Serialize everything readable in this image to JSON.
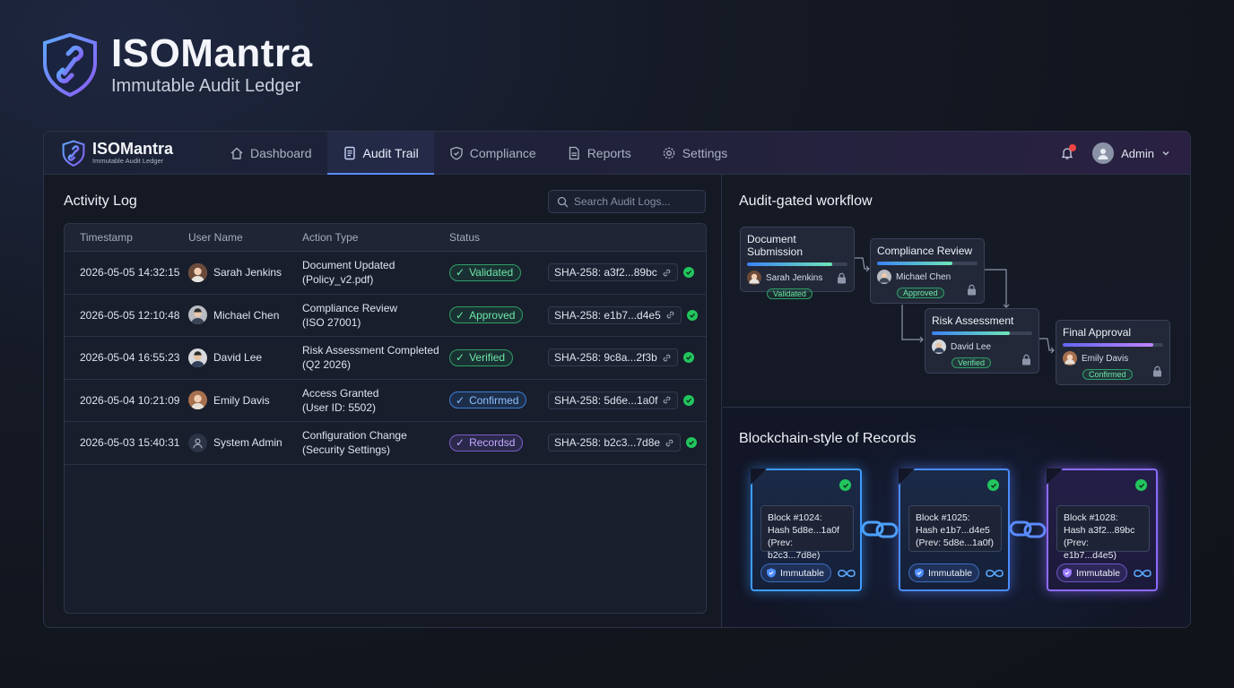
{
  "hero": {
    "title": "ISOMantra",
    "subtitle": "Immutable Audit Ledger"
  },
  "header": {
    "brand_name": "ISOMantra",
    "brand_sub": "Immutable Audit Ledger",
    "nav": [
      {
        "label": "Dashboard",
        "icon": "home-icon"
      },
      {
        "label": "Audit Trail",
        "icon": "document-icon",
        "active": true
      },
      {
        "label": "Compliance",
        "icon": "shield-check-icon"
      },
      {
        "label": "Reports",
        "icon": "report-icon"
      },
      {
        "label": "Settings",
        "icon": "gear-icon"
      }
    ],
    "user": "Admin"
  },
  "activity": {
    "title": "Activity Log",
    "search_placeholder": "Search Audit Logs...",
    "columns": [
      "Timestamp",
      "User Name",
      "Action Type",
      "Status"
    ],
    "rows": [
      {
        "timestamp": "2026-05-05 14:32:15",
        "user": "Sarah Jenkins",
        "action_1": "Document Updated",
        "action_2": "(Policy_v2.pdf)",
        "status": "Validated",
        "hash": "SHA-258: a3f2...89bc"
      },
      {
        "timestamp": "2026-05-05 12:10:48",
        "user": "Michael Chen",
        "action_1": "Compliance Review",
        "action_2": "(ISO 27001)",
        "status": "Approved",
        "hash": "SHA-258: e1b7...d4e5"
      },
      {
        "timestamp": "2026-05-04 16:55:23",
        "user": "David Lee",
        "action_1": "Risk Assessment Completed",
        "action_2": "(Q2 2026)",
        "status": "Verified",
        "hash": "SHA-258: 9c8a...2f3b"
      },
      {
        "timestamp": "2026-05-04 10:21:09",
        "user": "Emily Davis",
        "action_1": "Access Granted",
        "action_2": "(User ID: 5502)",
        "status": "Confirmed",
        "hash": "SHA-258: 5d6e...1a0f"
      },
      {
        "timestamp": "2026-05-03 15:40:31",
        "user": "System Admin",
        "action_1": "Configuration Change",
        "action_2": "(Security Settings)",
        "status": "Recordsd",
        "hash": "SHA-258: b2c3...7d8e"
      }
    ]
  },
  "workflow": {
    "title": "Audit-gated workflow",
    "steps": [
      {
        "title": "Document Submission",
        "user": "Sarah Jenkins",
        "status": "Validated",
        "progress": 0.85
      },
      {
        "title": "Compliance Review",
        "user": "Michael Chen",
        "status": "Approved",
        "progress": 0.75
      },
      {
        "title": "Risk Assessment",
        "user": "David Lee",
        "status": "Verified",
        "progress": 0.78
      },
      {
        "title": "Final Approval",
        "user": "Emily Davis",
        "status": "Confirmed",
        "progress": 0.9
      }
    ]
  },
  "blockchain": {
    "title": "Blockchain-style of Records",
    "blocks": [
      {
        "id": "Block #1024:",
        "hash": "Hash 5d8e...1a0f",
        "prev": "(Prev: b2c3...7d8e)",
        "badge": "Immutable"
      },
      {
        "id": "Block #1025:",
        "hash": "Hash e1b7...d4e5",
        "prev": "(Prev: 5d8e...1a0f)",
        "badge": "Immutable"
      },
      {
        "id": "Block #1028:",
        "hash": "Hash a3f2...89bc",
        "prev": "(Prev: e1b7...d4e5)",
        "badge": "Immutable"
      }
    ]
  },
  "colors": {
    "accent": "#5b8cff",
    "success": "#22c55e",
    "purple": "#8d6bff"
  }
}
